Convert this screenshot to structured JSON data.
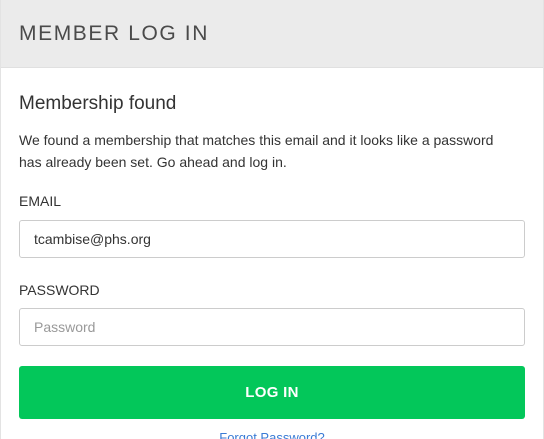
{
  "header": {
    "title": "MEMBER LOG IN"
  },
  "status": {
    "title": "Membership found",
    "message": "We found a membership that matches this email and it looks like a password has already been set. Go ahead and log in."
  },
  "form": {
    "email_label": "EMAIL",
    "email_value": "tcambise@phs.org",
    "password_label": "PASSWORD",
    "password_placeholder": "Password",
    "submit_label": "LOG IN",
    "forgot_label": "Forgot Password?"
  },
  "colors": {
    "header_bg": "#ebebeb",
    "button_bg": "#03c75a",
    "button_text": "#ffffff",
    "link": "#3a7bd5"
  }
}
